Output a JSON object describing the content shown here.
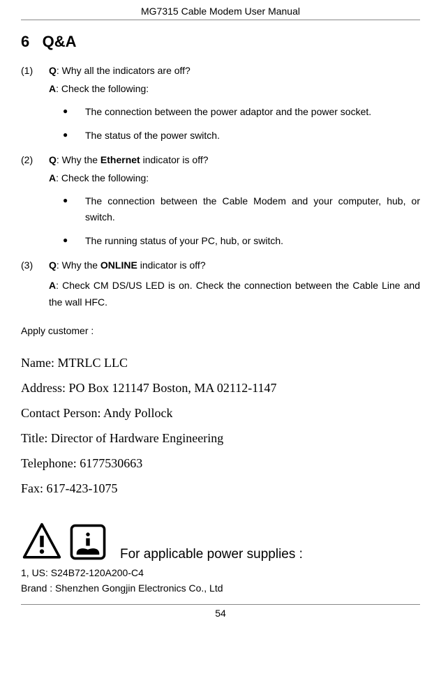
{
  "header_title": "MG7315 Cable Modem User Manual",
  "section_number": "6",
  "section_title": "Q&A",
  "qa": [
    {
      "num": "(1)",
      "q_label": "Q",
      "q_text": ": Why all the indicators are off?",
      "a_label": "A",
      "a_text": ": Check the following:",
      "bullets": [
        "The connection between the power adaptor and the power socket.",
        "The status of the power switch."
      ]
    },
    {
      "num": "(2)",
      "q_label": "Q",
      "q_pre": ": Why the ",
      "q_bold": "Ethernet",
      "q_post": " indicator is off?",
      "a_label": "A",
      "a_text": ": Check the following:",
      "bullets": [
        "The connection between the Cable Modem and your computer, hub, or switch.",
        "The running status of your PC, hub, or switch."
      ]
    },
    {
      "num": "(3)",
      "q_label": "Q",
      "q_pre": ": Why the ",
      "q_bold": "ONLINE",
      "q_post": " indicator is off?",
      "a_label": "A",
      "a_full": ": Check CM DS/US LED is on. Check the connection between the Cable Line and the wall HFC."
    }
  ],
  "apply_customer": "Apply customer :",
  "contact": {
    "name": "Name: MTRLC LLC",
    "address": "Address: PO Box 121147 Boston, MA    02112-1147",
    "person": "Contact Person: Andy Pollock",
    "title": "Title: Director of Hardware Engineering",
    "telephone": "Telephone: 6177530663",
    "fax": "Fax: 617-423-1075"
  },
  "power_supplies_label": "For applicable power supplies :",
  "supply_line1": "1, US: S24B72-120A200-C4",
  "supply_line2": "Brand : Shenzhen Gongjin Electronics Co., Ltd",
  "page_number": "54"
}
